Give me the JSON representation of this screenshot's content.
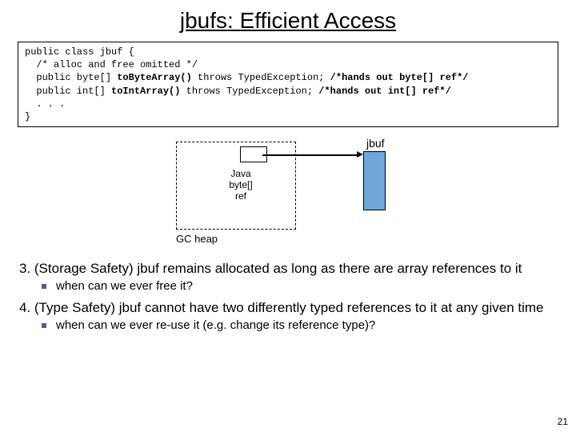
{
  "title": "jbufs: Efficient Access",
  "code": {
    "l1": "public class jbuf {",
    "l2": "  /* alloc and free omitted */",
    "l3a": "  public byte[] ",
    "l3b": "toByteArray()",
    "l3c": " throws TypedException; ",
    "l3d": "/*hands out byte[] ref*/",
    "l4a": "  public int[] ",
    "l4b": "toIntArray()",
    "l4c": " throws TypedException; ",
    "l4d": "/*hands out int[] ref*/",
    "l5": "  . . .",
    "l6": "}"
  },
  "diagram": {
    "gc_heap": "GC heap",
    "java_ref": "Java\nbyte[]\nref",
    "jbuf": "jbuf"
  },
  "points": {
    "p3": "3. (Storage Safety) jbuf remains allocated as long as there are array references to it",
    "p3_bullet": "when can we ever free it?",
    "p4": "4. (Type Safety) jbuf cannot have two differently typed references to it at any given time",
    "p4_bullet": "when can we ever re-use it (e.g. change its reference type)?"
  },
  "page_number": "21"
}
